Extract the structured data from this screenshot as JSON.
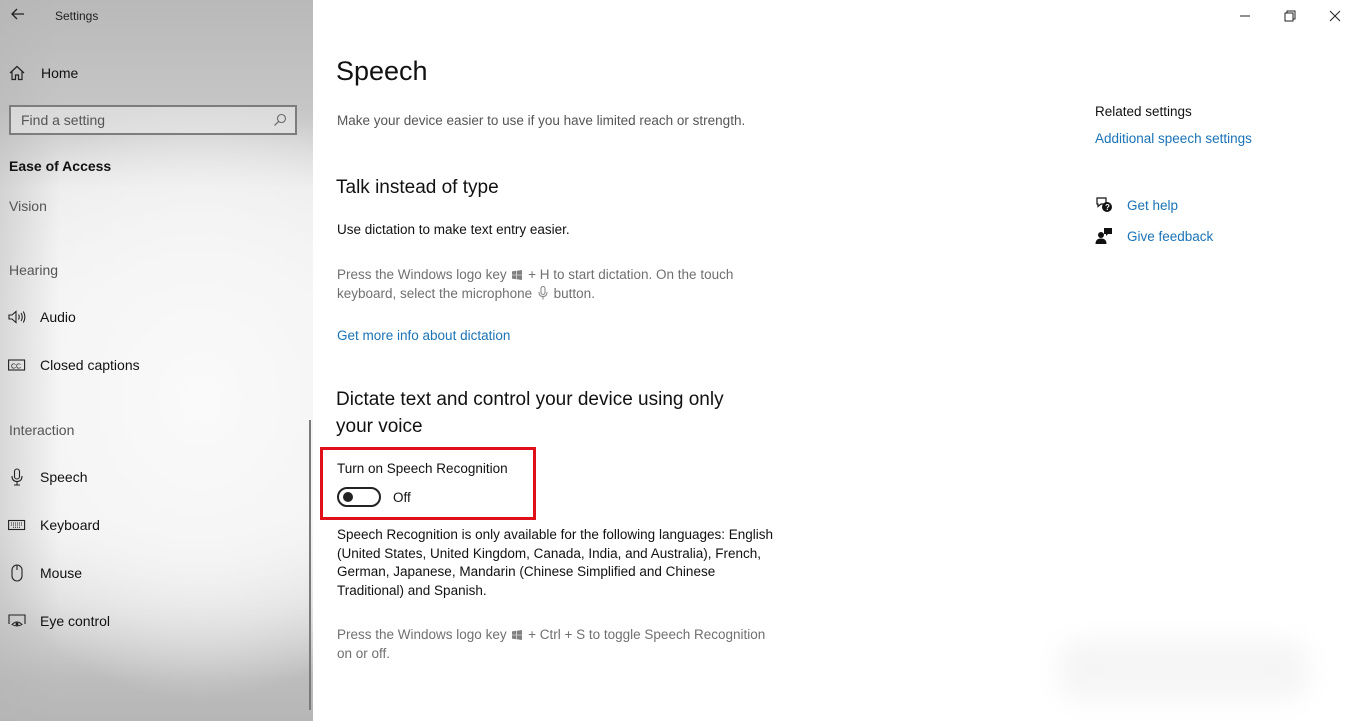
{
  "window": {
    "title": "Settings",
    "controls": {
      "minimize": "minimize-icon",
      "restore": "restore-icon",
      "close": "close-icon"
    }
  },
  "sidebar": {
    "home_label": "Home",
    "search_placeholder": "Find a setting",
    "section_title": "Ease of Access",
    "groups": [
      {
        "title": "Vision",
        "items": []
      },
      {
        "title": "Hearing",
        "items": [
          {
            "label": "Audio",
            "icon": "speaker-icon"
          },
          {
            "label": "Closed captions",
            "icon": "closed-captions-icon"
          }
        ]
      },
      {
        "title": "Interaction",
        "items": [
          {
            "label": "Speech",
            "icon": "microphone-icon",
            "selected": true
          },
          {
            "label": "Keyboard",
            "icon": "keyboard-icon"
          },
          {
            "label": "Mouse",
            "icon": "mouse-icon"
          },
          {
            "label": "Eye control",
            "icon": "eye-control-icon"
          }
        ]
      }
    ]
  },
  "main": {
    "title": "Speech",
    "description": "Make your device easier to use if you have limited reach or strength.",
    "talk_section": {
      "heading": "Talk instead of type",
      "intro": "Use dictation to make text entry easier.",
      "hint_part1": "Press the Windows logo key",
      "hint_part2": "+ H to start dictation.  On the touch",
      "hint_part3": "keyboard, select the microphone",
      "hint_part4": "button.",
      "link": "Get more info about dictation"
    },
    "dictate_section": {
      "heading_line1": "Dictate text and control your device using only",
      "heading_line2": "your voice",
      "toggle_label": "Turn on Speech Recognition",
      "toggle_on": false,
      "toggle_state": "Off",
      "languages_text": [
        "Speech Recognition is only available for the following languages: English",
        "(United States, United Kingdom, Canada, India, and Australia), French,",
        "German, Japanese, Mandarin (Chinese Simplified and Chinese",
        "Traditional) and Spanish."
      ],
      "shortcut_part1": "Press the Windows logo key",
      "shortcut_part2": "+ Ctrl + S to toggle Speech Recognition",
      "shortcut_line2": "on or off."
    }
  },
  "related": {
    "title": "Related settings",
    "link": "Additional speech settings",
    "get_help": "Get help",
    "give_feedback": "Give feedback"
  },
  "colors": {
    "link": "#1a73b5",
    "highlight": "#e0101a"
  }
}
